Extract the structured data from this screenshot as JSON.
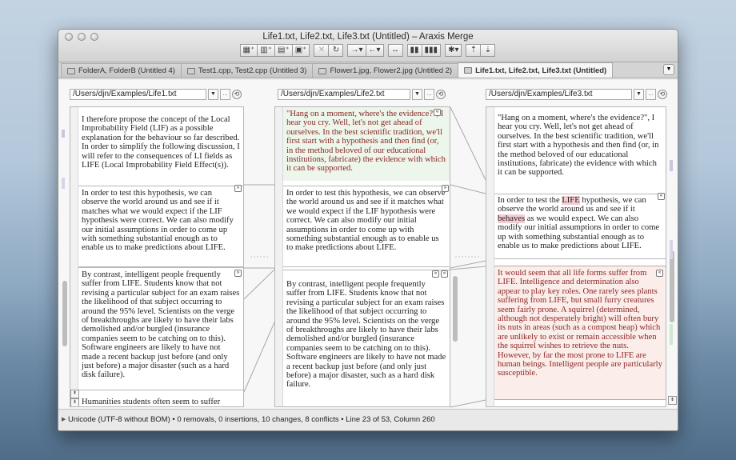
{
  "window": {
    "title": "Life1.txt, Life2.txt, Life3.txt (Untitled) – Araxis Merge"
  },
  "toolbar": {
    "groups": [
      [
        "new-folder-compare",
        "new-two-way-compare",
        "new-three-way-compare",
        "new-image-compare"
      ],
      [
        "close-compare",
        "refresh"
      ],
      [
        "copy-right",
        "copy-left"
      ],
      [
        "merge"
      ],
      [
        "two-panes",
        "three-panes"
      ],
      [
        "settings"
      ],
      [
        "previous-change",
        "next-change"
      ]
    ],
    "glyphs": [
      "▦⁺",
      "▥⁺",
      "▤⁺",
      "▣⁺",
      "✕",
      "↻",
      "→▾",
      "←▾",
      "↔",
      "▮▮",
      "▮▮▮",
      "✱▾",
      "⇡",
      "⇣"
    ]
  },
  "tabs": [
    {
      "label": "FolderA, FolderB (Untitled 4)",
      "icon": "folder-icon",
      "active": false
    },
    {
      "label": "Test1.cpp, Test2.cpp (Untitled 3)",
      "icon": "text-document-icon",
      "active": false
    },
    {
      "label": "Flower1.jpg, Flower2.jpg (Untitled 2)",
      "icon": "image-document-icon",
      "active": false
    },
    {
      "label": "Life1.txt, Life2.txt, Life3.txt (Untitled)",
      "icon": "text-document-icon",
      "active": true
    }
  ],
  "tab_menu_glyph": "▼",
  "panes": [
    {
      "path": "/Users/djn/Examples/Life1.txt",
      "blocks": [
        {
          "text": "I therefore propose the concept of the Local Improbability Field (LIF) as a possible explanation for the behaviour so far described. In order to simplify the following discussion, I will refer to the consequences of LI fields as LIFE (Local Improbability Field Effect(s)).",
          "style": "plain"
        },
        {
          "text": "In order to test this hypothesis, we can observe the world around us and see if it matches what we would expect if the LIF hypothesis were correct. We can also modify our initial assumptions in order to come up with something substantial enough as to enable us to make predictions about LIFE.",
          "style": "changed"
        },
        {
          "text": "By contrast, intelligent people frequently suffer from LIFE. Students know that not revising a particular subject for an exam raises the likelihood of that subject occurring to around the 95% level. Scientists on the verge of breakthroughs are likely to have their labs demolished and/or burgled (insurance companies seem to be catching on to this). Software engineers are likely to have not made a recent backup just before (and only just before) a major disaster (such as a hard disk failure).",
          "style": "changed"
        },
        {
          "text": "Humanities students often seem to suffer",
          "style": "plain"
        }
      ]
    },
    {
      "path": "/Users/djn/Examples/Life2.txt",
      "blocks": [
        {
          "text": "\"Hang on a moment, where's the evidence?\", I hear you cry. Well, let's not get ahead of ourselves. In the best scientific tradition, we'll first start with a hypothesis and then find (or, in the method beloved of our educational institutions, fabricate) the evidence with which it can be supported.",
          "style": "green"
        },
        {
          "text": "In order to test this hypothesis, we can observe the world around us and see if it matches what we would expect if the LIF hypothesis were correct. We can also modify our initial assumptions in order to come up with something substantial enough as to enable us to make predictions about LIFE.",
          "style": "changed"
        },
        {
          "text": "By contrast, intelligent people frequently suffer from LIFE. Students know that not revising a particular subject for an exam raises the likelihood of that subject occurring to around the 95% level. Scientists on the verge of breakthroughs are likely to have their labs demolished and/or burgled (insurance companies seem to be catching on to this). Software engineers are likely to have not made a recent backup just before (and only just before) a major disaster, such as a hard disk failure.",
          "style": "changed"
        }
      ]
    },
    {
      "path": "/Users/djn/Examples/Life3.txt",
      "blocks": [
        {
          "text": "\"Hang on a moment, where's the evidence?\", I hear you cry. Well, let's not get ahead of ourselves. In the best scientific tradition, we'll first start with a hypothesis and then find (or, in the method beloved of our educational institutions, fabricate) the evidence with which it can be supported.",
          "style": "plain"
        },
        {
          "text": "In order to test the LIFE hypothesis, we can observe the world around us and see if it behaves as we would expect. We can also modify our initial assumptions in order to come up with something substantial enough as to enable us to make predictions about LIFE.",
          "style": "changed-hl"
        },
        {
          "text": "It would seem that all life forms suffer from LIFE. Intelligence and determination also appear to play key roles. One rarely sees plants suffering from LIFE, but small furry creatures seem fairly prone. A squirrel (determined, although not desperately bright) will often bury its nuts in areas (such as a compost heap) which are unlikely to exist or remain accessible when the squirrel wishes to retrieve the nuts. However, by far the most prone to LIFE are human beings. Intelligent people are particularly susceptible.",
          "style": "red"
        }
      ]
    }
  ],
  "pane3_hl": {
    "a": "In order to test the ",
    "b": "LIFE",
    "c": " hypothesis, we can observe the world around us and see if it ",
    "d": "behaves",
    "e": " as we would expect. We can also modify our initial assumptions in order to come up with something substantial enough as to enable us to make predictions about LIFE."
  },
  "buttons": {
    "path_dropdown": "▼",
    "path_more": "…",
    "history": "⟲",
    "merge_right": "»",
    "merge_left": "«",
    "nav_up": "⇞",
    "nav_down": "⇟"
  },
  "status": {
    "text": "Unicode (UTF-8 without BOM) • 0 removals, 0 insertions, 10 changes, 8 conflicts • Line 23 of 53, Column 260",
    "triangle": "▶"
  },
  "colors": {
    "changed_text": "#8a2626",
    "inserted_bg": "#edf6ea",
    "conflict_bg": "#fbeeea",
    "highlight": "#f3cdd2"
  }
}
